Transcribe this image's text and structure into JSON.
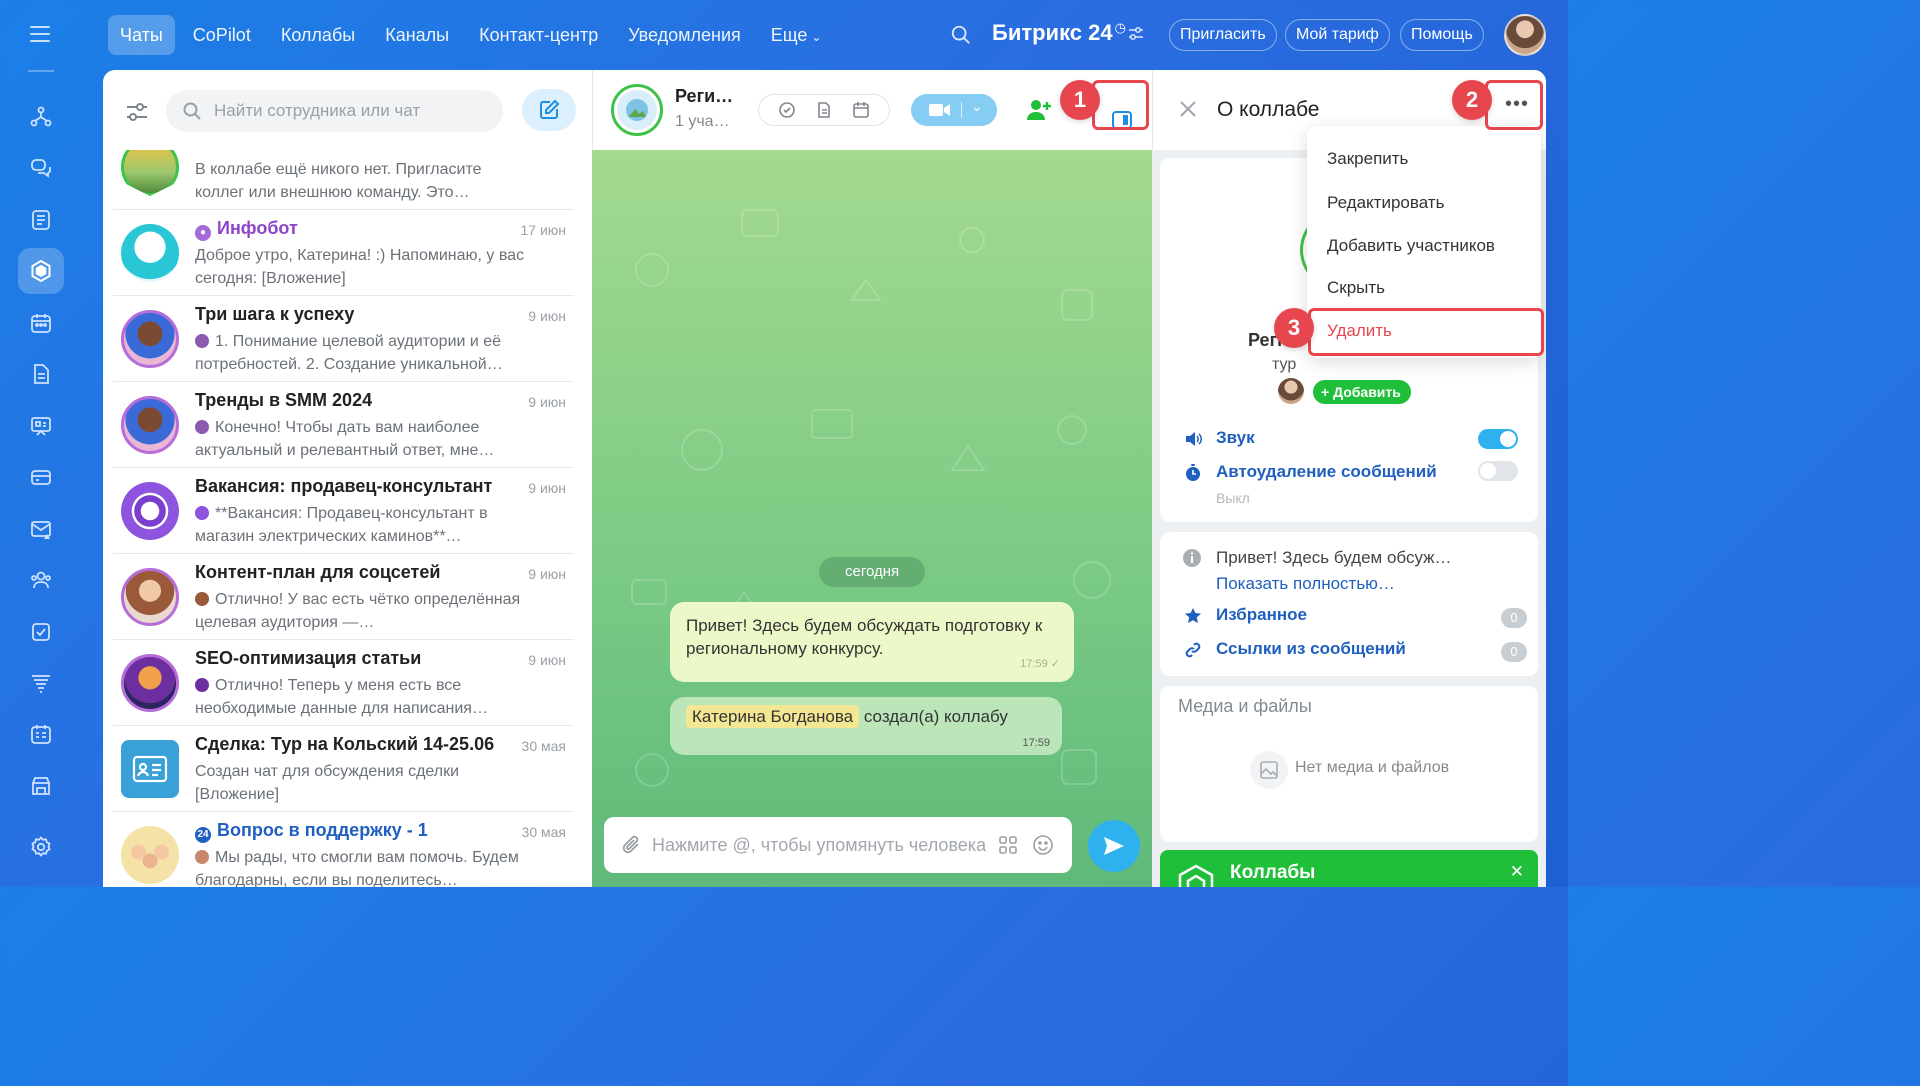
{
  "topbar": {
    "nav": [
      {
        "label": "Чаты",
        "active": true
      },
      {
        "label": "CoPilot"
      },
      {
        "label": "Коллабы"
      },
      {
        "label": "Каналы"
      },
      {
        "label": "Контакт-центр"
      },
      {
        "label": "Уведомления"
      },
      {
        "label": "Еще"
      }
    ],
    "brand": "Битрикс 24",
    "buttons": {
      "invite": "Пригласить",
      "plan": "Мой тариф",
      "help": "Помощь"
    }
  },
  "sidebar_icons": [
    "sitemap-icon",
    "chat-bubbles-icon",
    "feed-icon",
    "collab-hexagon-icon",
    "calendar-icon",
    "document-icon",
    "board-icon",
    "crm-card-icon",
    "mail-icon",
    "team-icon",
    "tasks-icon",
    "funnel-icon",
    "schedule-icon",
    "store-icon",
    "settings-icon"
  ],
  "chatlist": {
    "search_placeholder": "Найти сотрудника или чат",
    "items": [
      {
        "title": "",
        "date": "",
        "preview": "В коллабе ещё никого нет. Пригласите коллег или внешнюю команду. Это…"
      },
      {
        "title": "Инфобот",
        "date": "17 июн",
        "preview": "Доброе утро, Катерина! :) Напоминаю, у вас сегодня: [Вложение]"
      },
      {
        "title": "Три шага к успеху",
        "date": "9 июн",
        "preview": "1. Понимание целевой аудитории и её потребностей. 2. Создание уникальной…"
      },
      {
        "title": "Тренды в SMM 2024",
        "date": "9 июн",
        "preview": "Конечно! Чтобы дать вам наиболее актуальный и релевантный ответ, мне…"
      },
      {
        "title": "Вакансия: продавец-консультант",
        "date": "9 июн",
        "preview": "**Вакансия: Продавец-консультант в магазин электрических каминов**…"
      },
      {
        "title": "Контент-план для соцсетей",
        "date": "9 июн",
        "preview": "Отлично! У вас есть чётко определённая целевая аудитория —…"
      },
      {
        "title": "SEO-оптимизация статьи",
        "date": "9 июн",
        "preview": "Отлично! Теперь у меня есть все необходимые данные для написания…"
      },
      {
        "title": "Сделка: Тур на Кольский 14-25.06",
        "date": "30 мая",
        "preview": "Создан чат для обсуждения сделки [Вложение]"
      },
      {
        "title": "Вопрос в поддержку - 1",
        "title_badge": "24",
        "date": "30 мая",
        "preview": "Мы рады, что смогли вам помочь. Будем благодарны, если вы поделитесь…"
      }
    ]
  },
  "chat": {
    "title": "Реги…",
    "subtitle": "1 уча…",
    "date_divider": "сегодня",
    "messages": [
      {
        "text": "Привет! Здесь будем обсуждать подготовку к региональному конкурсу.",
        "time": "17:59"
      },
      {
        "name": "Катерина Богданова",
        "text": "создал(а) коллабу",
        "time": "17:59"
      }
    ],
    "composer_placeholder": "Нажмите @, чтобы упомянуть человека"
  },
  "info_panel": {
    "title": "О коллабе",
    "name_line1": "Регі",
    "name_line2": "тур",
    "add_button": "+ Добавить",
    "sound_label": "Звук",
    "sound_on": true,
    "autodelete_label": "Автоудаление сообщений",
    "autodelete_on": false,
    "autodelete_value": "Выкл",
    "description": "Привет! Здесь будем обсуж…",
    "show_more": "Показать полностью…",
    "favorites_label": "Избранное",
    "favorites_count": "0",
    "links_label": "Ссылки из сообщений",
    "links_count": "0",
    "media_title": "Медиа и файлы",
    "no_media": "Нет медиа и файлов",
    "banner_title": "Коллабы"
  },
  "menu": {
    "items": [
      "Закрепить",
      "Редактировать",
      "Добавить участников",
      "Скрыть",
      "Удалить"
    ]
  },
  "annotations": {
    "step1": "1",
    "step2": "2",
    "step3": "3"
  },
  "colors": {
    "accent": "#2fb1f0",
    "highlight": "#e8464e",
    "collab_green": "#1fbf3a",
    "link_blue": "#1f5fbf"
  }
}
